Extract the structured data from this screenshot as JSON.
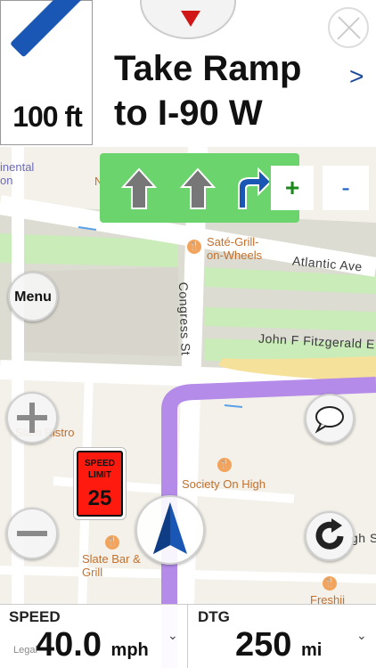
{
  "instruction": {
    "distance": "100 ft",
    "text_line1": "Take Ramp",
    "text_line2": "to I-90 W",
    "maneuver_icon": "ramp-left-icon"
  },
  "map": {
    "streets": {
      "atlantic": "Atlantic Ave",
      "congress": "Congress St",
      "jfk": "John F Fitzgerald E"
    },
    "pois": {
      "nebo": "Nebo",
      "sate_line1": "Saté-Grill-",
      "sate_line2": "on-Wheels",
      "siam": "Siam Bistro",
      "society": "Society On High",
      "slate_line1": "Slate Bar &",
      "slate_line2": "Grill",
      "freshii": "Freshii",
      "continental_line1": "inental",
      "continental_line2": "on",
      "high": "gh S"
    },
    "legal": "Legal"
  },
  "lanes": {
    "arrows": [
      "straight-arrow-icon",
      "straight-arrow-icon",
      "right-turn-arrow-icon"
    ],
    "zoom_in": "+",
    "zoom_out": "-"
  },
  "buttons": {
    "menu": "Menu"
  },
  "speed_limit": {
    "label_line1": "SPEED",
    "label_line2": "LIMIT",
    "value": "25"
  },
  "stats": {
    "speed_label": "SPEED",
    "speed_value": "40.0",
    "speed_unit": "mph",
    "dtg_label": "DTG",
    "dtg_value": "250",
    "dtg_unit": "mi"
  },
  "colors": {
    "route": "#b48be8",
    "lane_panel": "#6cd46c",
    "maneuver": "#1a57b4",
    "speed_limit_bg": "#ff1a0f"
  }
}
